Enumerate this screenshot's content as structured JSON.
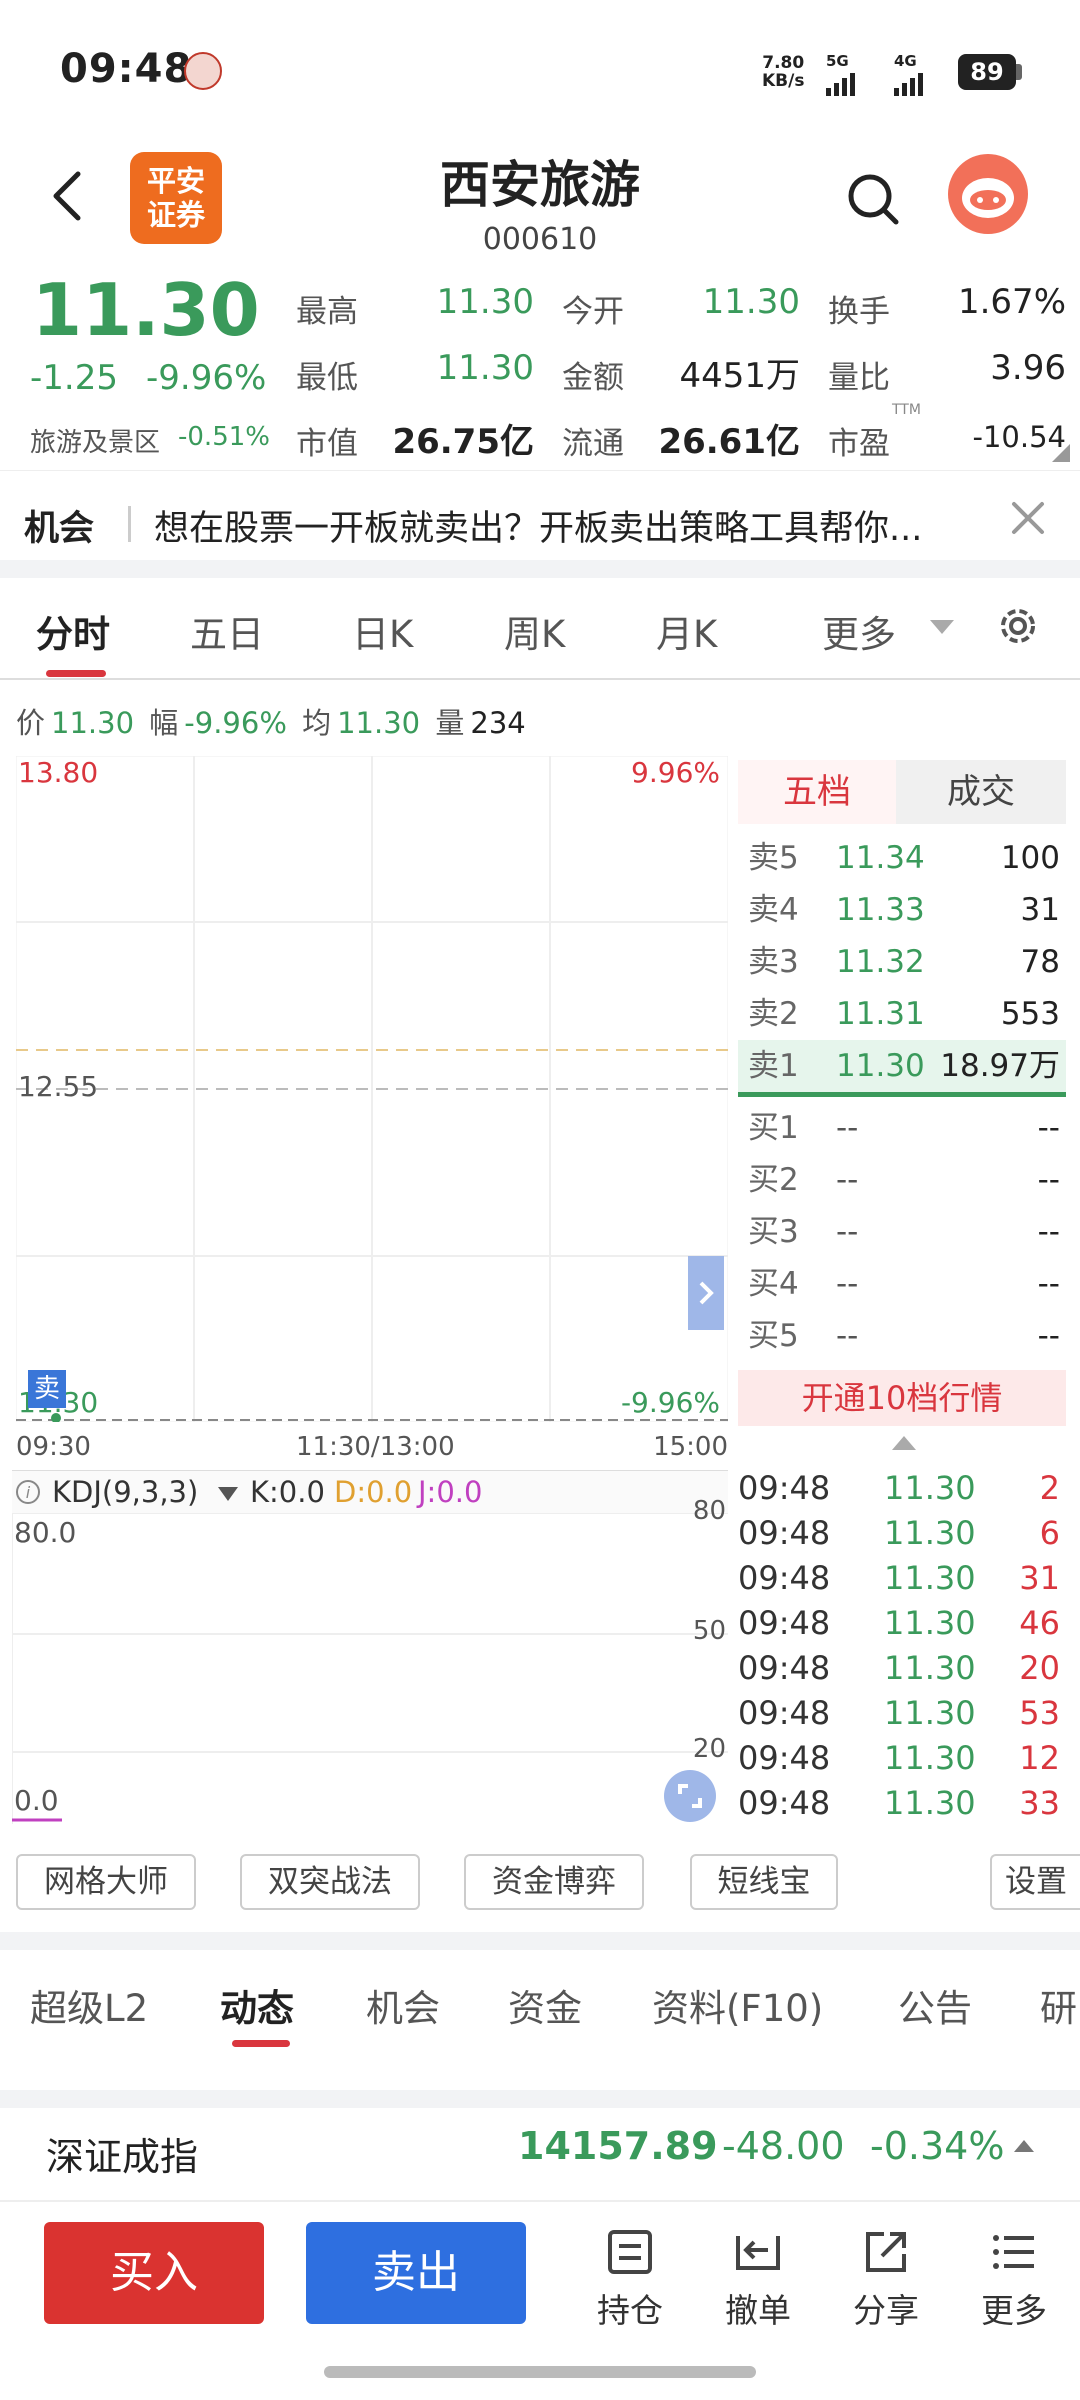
{
  "status": {
    "time": "09:48",
    "net_speed_value": "7.80",
    "net_speed_unit": "KB/s",
    "sig1": "5G",
    "sig2": "4G",
    "battery": "89"
  },
  "header": {
    "title": "西安旅游",
    "code": "000610",
    "logo_text": "平安证券"
  },
  "quote": {
    "price": "11.30",
    "change": "-1.25",
    "change_pct": "-9.96%",
    "sector": "旅游及景区",
    "sector_chg": "-0.51%",
    "stats": [
      {
        "label": "最高",
        "value": "11.30",
        "color": "#3a9a5b"
      },
      {
        "label": "今开",
        "value": "11.30",
        "color": "#3a9a5b"
      },
      {
        "label": "换手",
        "value": "1.67%",
        "color": "#222222"
      },
      {
        "label": "最低",
        "value": "11.30",
        "color": "#3a9a5b"
      },
      {
        "label": "金额",
        "value": "4451万",
        "color": "#222222"
      },
      {
        "label": "量比",
        "value": "3.96",
        "color": "#222222"
      },
      {
        "label": "市值",
        "value": "26.75亿",
        "color": "#222222"
      },
      {
        "label": "流通",
        "value": "26.61亿",
        "color": "#222222"
      },
      {
        "label": "市盈",
        "value": "-10.54",
        "color": "#222222"
      }
    ],
    "pe_sup": "TTM"
  },
  "banner": {
    "tag": "机会",
    "text": "想在股票一开板就卖出？开板卖出策略工具帮你..."
  },
  "chart_tabs": [
    "分时",
    "五日",
    "日K",
    "周K",
    "月K",
    "更多"
  ],
  "info_row": {
    "price_label": "价",
    "price": "11.30",
    "range_label": "幅",
    "range": "-9.96%",
    "avg_label": "均",
    "avg": "11.30",
    "vol_label": "量",
    "vol": "234"
  },
  "chart_labels": {
    "top_price": "13.80",
    "top_pct": "9.96%",
    "mid_price": "12.55",
    "bottom_price": "11.30",
    "bottom_pct": "-9.96%",
    "sell_marker": "卖",
    "t_start": "09:30",
    "t_mid": "11:30/13:00",
    "t_end": "15:00"
  },
  "order_book": {
    "tab_five": "五档",
    "tab_deals": "成交",
    "sells": [
      {
        "name": "卖5",
        "price": "11.34",
        "vol": "100"
      },
      {
        "name": "卖4",
        "price": "11.33",
        "vol": "31"
      },
      {
        "name": "卖3",
        "price": "11.32",
        "vol": "78"
      },
      {
        "name": "卖2",
        "price": "11.31",
        "vol": "553"
      },
      {
        "name": "卖1",
        "price": "11.30",
        "vol": "18.97万"
      }
    ],
    "buys": [
      {
        "name": "买1",
        "price": "--",
        "vol": "--"
      },
      {
        "name": "买2",
        "price": "--",
        "vol": "--"
      },
      {
        "name": "买3",
        "price": "--",
        "vol": "--"
      },
      {
        "name": "买4",
        "price": "--",
        "vol": "--"
      },
      {
        "name": "买5",
        "price": "--",
        "vol": "--"
      }
    ],
    "open10": "开通10档行情"
  },
  "deals": [
    {
      "time": "09:48",
      "price": "11.30",
      "vol": "2"
    },
    {
      "time": "09:48",
      "price": "11.30",
      "vol": "6"
    },
    {
      "time": "09:48",
      "price": "11.30",
      "vol": "31"
    },
    {
      "time": "09:48",
      "price": "11.30",
      "vol": "46"
    },
    {
      "time": "09:48",
      "price": "11.30",
      "vol": "20"
    },
    {
      "time": "09:48",
      "price": "11.30",
      "vol": "53"
    },
    {
      "time": "09:48",
      "price": "11.30",
      "vol": "12"
    },
    {
      "time": "09:48",
      "price": "11.30",
      "vol": "33"
    }
  ],
  "kdj": {
    "name": "KDJ(9,3,3)",
    "k": "K:0.0",
    "d": "D:0.0",
    "j": "J:0.0",
    "top": "80.0",
    "bottom": "0.0",
    "r80": "80",
    "r50": "50",
    "r20": "20"
  },
  "tools": [
    "网格大师",
    "双突战法",
    "资金博弈",
    "短线宝",
    "设置"
  ],
  "bottom_tabs": [
    "超级L2",
    "动态",
    "机会",
    "资金",
    "资料(F10)",
    "公告",
    "研"
  ],
  "index_bar": {
    "name": "深证成指",
    "value": "14157.89",
    "change": "-48.00",
    "pct": "-0.34%"
  },
  "actions": {
    "buy": "买入",
    "sell": "卖出",
    "hold": "持仓",
    "cancel": "撤单",
    "share": "分享",
    "more": "更多"
  }
}
